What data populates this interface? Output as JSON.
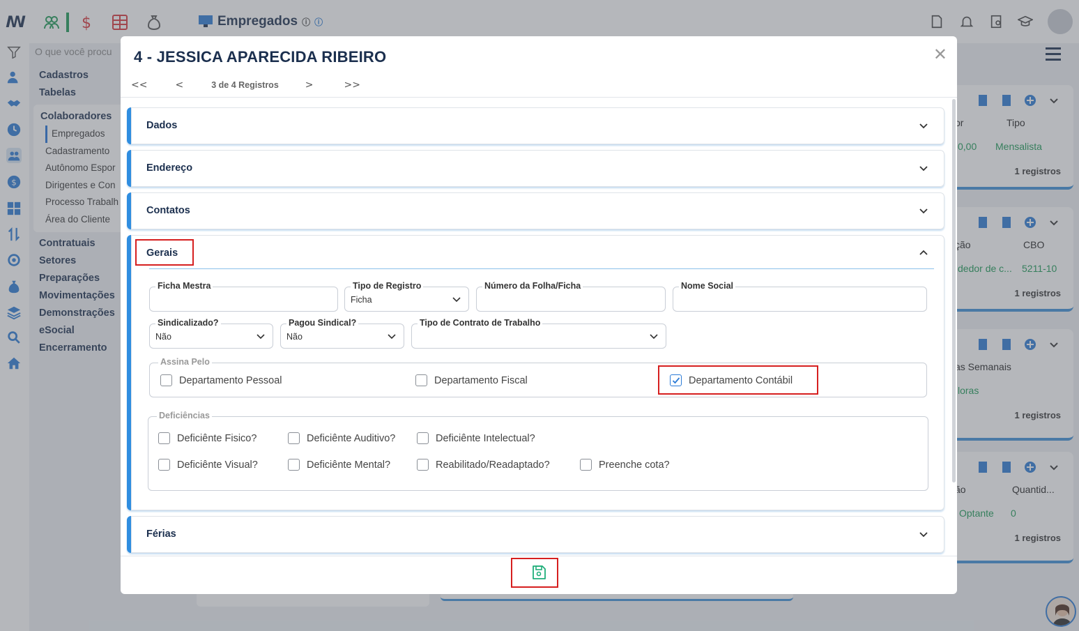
{
  "app": {
    "page_title": "Empregados",
    "search_placeholder": "O que você procu",
    "sidebar_menu": [
      "Cadastros",
      "Tabelas"
    ],
    "sidebar_group_title": "Colaboradores",
    "sidebar_group_items": [
      "Empregados",
      "Cadastramento",
      "Autônomo Espor",
      "Dirigentes e Con",
      "Processo Trabalh",
      "Área do Cliente"
    ],
    "sidebar_menu_after": [
      "Contratuais",
      "Setores",
      "Preparações",
      "Movimentações",
      "Demonstrações",
      "eSocial",
      "Encerramento"
    ],
    "right_cards": [
      {
        "col1": "or",
        "col2": "Tipo",
        "val1": "0,00",
        "val2": "Mensalista",
        "records": "1 registros"
      },
      {
        "col1": "ção",
        "col2": "CBO",
        "val1": "dedor de c...",
        "val2": "5211-10",
        "records": "1 registros"
      },
      {
        "col1": "as Semanais",
        "col2": "",
        "val1": "loras",
        "val2": "",
        "records": "1 registros"
      },
      {
        "col1": "ão",
        "col2": "Quantid...",
        "val1": "Optante",
        "val2": "0",
        "records": "1 registros"
      }
    ],
    "colors": {
      "brand": "#1b2f4e",
      "accent": "#2f8de0",
      "green": "#1a9a55",
      "highlight": "#d61f1f"
    }
  },
  "modal": {
    "title": "4 - JESSICA APARECIDA RIBEIRO",
    "close_label": "✕",
    "pager": {
      "first": "<<",
      "prev": "<",
      "counter": "3 de 4 Registros",
      "next": ">",
      "last": ">>"
    },
    "sections": {
      "dados": "Dados",
      "endereco": "Endereço",
      "contatos": "Contatos",
      "gerais": "Gerais",
      "ferias": "Férias"
    },
    "gerais": {
      "ficha_mestra": {
        "label": "Ficha Mestra",
        "value": ""
      },
      "tipo_registro": {
        "label": "Tipo de Registro",
        "value": "Ficha"
      },
      "numero_folha": {
        "label": "Número da Folha/Ficha",
        "value": ""
      },
      "nome_social": {
        "label": "Nome Social",
        "value": ""
      },
      "sindicalizado": {
        "label": "Sindicalizado?",
        "value": "Não"
      },
      "pagou_sindical": {
        "label": "Pagou Sindical?",
        "value": "Não"
      },
      "tipo_contrato": {
        "label": "Tipo de Contrato de Trabalho",
        "value": ""
      },
      "assina_pelo": {
        "label": "Assina Pelo",
        "options": [
          {
            "label": "Departamento Pessoal",
            "checked": false
          },
          {
            "label": "Departamento Fiscal",
            "checked": false
          },
          {
            "label": "Departamento Contábil",
            "checked": true
          }
        ]
      },
      "deficiencias": {
        "label": "Deficiências",
        "options": [
          {
            "label": "Deficiênte Fisico?",
            "checked": false
          },
          {
            "label": "Deficiênte Auditivo?",
            "checked": false
          },
          {
            "label": "Deficiênte Intelectual?",
            "checked": false
          },
          {
            "label": "Deficiênte Visual?",
            "checked": false
          },
          {
            "label": "Deficiênte Mental?",
            "checked": false
          },
          {
            "label": "Reabilitado/Readaptado?",
            "checked": false
          },
          {
            "label": "Preenche cota?",
            "checked": false
          }
        ]
      }
    },
    "save_icon": "floppy-save-icon"
  }
}
